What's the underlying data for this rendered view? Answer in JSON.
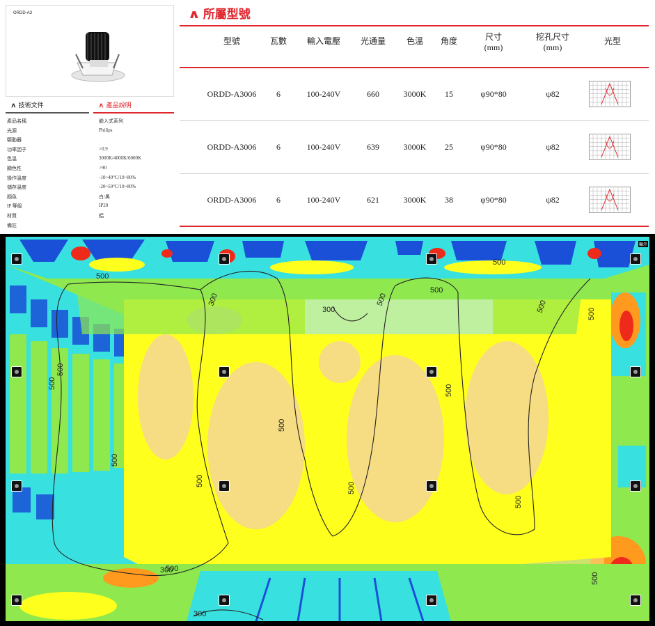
{
  "product": {
    "model_code": "ORDD-A3",
    "tabs": {
      "docs": "技術文件",
      "desc": "產品說明"
    },
    "specs": [
      {
        "k": "產品名稱",
        "v": "嵌入式系列"
      },
      {
        "k": "光源",
        "v": "Philips"
      },
      {
        "k": "驅動器",
        "v": ""
      },
      {
        "k": "功率因子",
        "v": ">0.9"
      },
      {
        "k": "色溫",
        "v": "3000K/4000K/6000K"
      },
      {
        "k": "顯色性",
        "v": ">90"
      },
      {
        "k": "操作溫度",
        "v": "-10~40°C/10~80%"
      },
      {
        "k": "儲存溫度",
        "v": "-20~50°C/10~80%"
      },
      {
        "k": "顏色",
        "v": "白/黑"
      },
      {
        "k": "IP 等級",
        "v": "IP20"
      },
      {
        "k": "材質",
        "v": "鋁"
      },
      {
        "k": "備註",
        "v": ""
      }
    ]
  },
  "models": {
    "title": "所屬型號",
    "headers": {
      "model": "型號",
      "watt": "瓦數",
      "voltage": "輸入電壓",
      "lumen": "光通量",
      "cct": "色溫",
      "angle": "角度",
      "size": "尺寸",
      "size_unit": "(mm)",
      "cutout": "挖孔尺寸",
      "cutout_unit": "(mm)",
      "beam": "光型"
    },
    "rows": [
      {
        "model": "ORDD-A3006",
        "watt": "6",
        "voltage": "100-240V",
        "lumen": "660",
        "cct": "3000K",
        "angle": "15",
        "size": "ψ90*80",
        "cutout": "ψ82"
      },
      {
        "model": "ORDD-A3006",
        "watt": "6",
        "voltage": "100-240V",
        "lumen": "639",
        "cct": "3000K",
        "angle": "25",
        "size": "ψ90*80",
        "cutout": "ψ82"
      },
      {
        "model": "ORDD-A3006",
        "watt": "6",
        "voltage": "100-240V",
        "lumen": "621",
        "cct": "3000K",
        "angle": "38",
        "size": "ψ90*80",
        "cutout": "ψ82"
      }
    ]
  },
  "render": {
    "corner_label": "顯示",
    "contour_labels": [
      "500",
      "300",
      "500",
      "500",
      "500",
      "500",
      "300",
      "300",
      "500",
      "500",
      "500",
      "500",
      "500",
      "500",
      "500",
      "500",
      "300",
      "500",
      "500",
      "500"
    ],
    "colors": {
      "yellow": "#ffff1e",
      "tan": "#f6dc82",
      "green": "#8ee84e",
      "cyan": "#38e0e0",
      "blue": "#1a4fd8",
      "red": "#ee2a1a",
      "orange": "#ff9a1e"
    }
  }
}
